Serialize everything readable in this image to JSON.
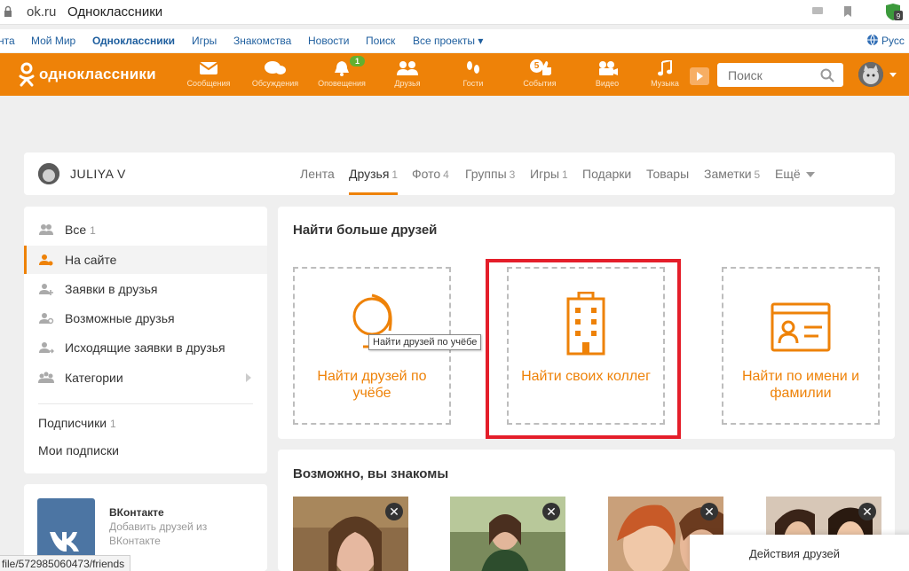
{
  "browser": {
    "domain": "ok.ru",
    "page_title": "Одноклассники"
  },
  "portal": {
    "items": [
      {
        "label": "нта"
      },
      {
        "label": "Мой Мир"
      },
      {
        "label": "Одноклассники"
      },
      {
        "label": "Игры"
      },
      {
        "label": "Знакомства"
      },
      {
        "label": "Новости"
      },
      {
        "label": "Поиск"
      },
      {
        "label": "Все проекты ▾"
      }
    ],
    "lang": "Русс"
  },
  "toolbar": {
    "logo": "одноклассники",
    "nav": [
      {
        "label": "Сообщения",
        "icon": "envelope-icon"
      },
      {
        "label": "Обсуждения",
        "icon": "chat-bubbles-icon"
      },
      {
        "label": "Оповещения",
        "icon": "bell-icon",
        "badge": "1"
      },
      {
        "label": "Друзья",
        "icon": "friends-icon"
      },
      {
        "label": "Гости",
        "icon": "footprints-icon"
      },
      {
        "label": "События",
        "icon": "like-icon",
        "badge": "5"
      },
      {
        "label": "Видео",
        "icon": "video-camera-icon"
      },
      {
        "label": "Музыка",
        "icon": "music-note-icon"
      }
    ],
    "search_placeholder": "Поиск",
    "accent": "#ee8208"
  },
  "profile": {
    "name": "JULIYA V",
    "tabs": [
      {
        "label": "Лента",
        "count": ""
      },
      {
        "label": "Друзья",
        "count": "1"
      },
      {
        "label": "Фото",
        "count": "4"
      },
      {
        "label": "Группы",
        "count": "3"
      },
      {
        "label": "Игры",
        "count": "1"
      },
      {
        "label": "Подарки",
        "count": ""
      },
      {
        "label": "Товары",
        "count": ""
      },
      {
        "label": "Заметки",
        "count": "5"
      },
      {
        "label": "Ещё",
        "count": ""
      }
    ]
  },
  "left_menu": {
    "items": [
      {
        "label": "Все",
        "count": "1"
      },
      {
        "label": "На сайте",
        "count": ""
      },
      {
        "label": "Заявки в друзья",
        "count": ""
      },
      {
        "label": "Возможные друзья",
        "count": ""
      },
      {
        "label": "Исходящие заявки в друзья",
        "count": ""
      },
      {
        "label": "Категории",
        "count": ""
      }
    ],
    "subscribers": {
      "label": "Подписчики",
      "count": "1"
    },
    "subscriptions": "Мои подписки"
  },
  "vk": {
    "title": "ВКонтакте",
    "sub1": "Добавить друзей из",
    "sub2": "ВКонтакте"
  },
  "find": {
    "title": "Найти больше друзей",
    "cards": [
      {
        "label": "Найти друзей по учёбе",
        "icon": "globe-icon"
      },
      {
        "label": "Найти своих коллег",
        "icon": "office-building-icon"
      },
      {
        "label": "Найти по имени и фамилии",
        "icon": "id-card-icon"
      }
    ],
    "tooltip": "Найти друзей по учёбе",
    "highlight_color": "#e41e2a"
  },
  "known": {
    "title": "Возможно, вы знакомы",
    "close_glyph": "✕"
  },
  "actions_popup": "Действия друзей",
  "status_url": "file/572985060473/friends"
}
